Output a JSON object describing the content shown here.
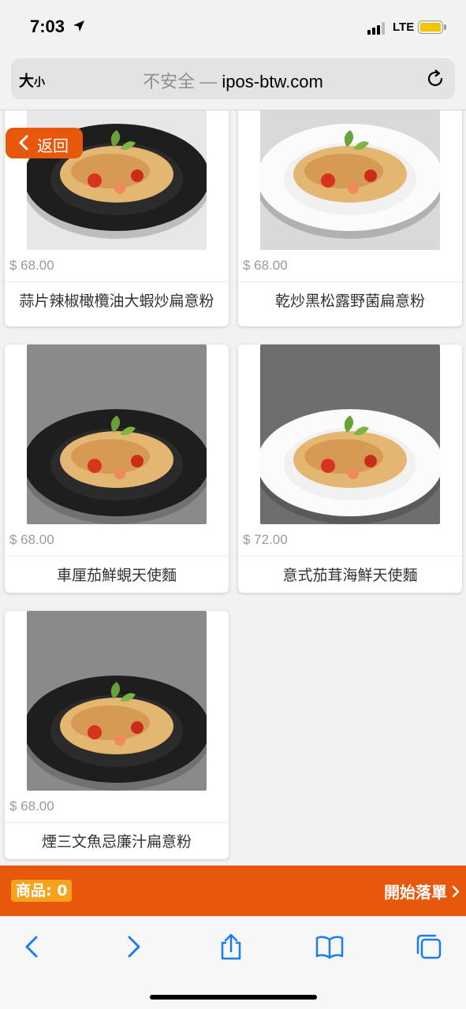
{
  "status_bar": {
    "time": "7:03",
    "network": "LTE",
    "battery_color": "#f5c400"
  },
  "browser": {
    "text_size_label_big": "大",
    "text_size_label_small": "小",
    "insecure_label": "不安全 —",
    "domain": "ipos-btw.com"
  },
  "page": {
    "back_label": "返回",
    "accent_color": "#e8580c",
    "products": [
      {
        "price": "$ 68.00",
        "name": "蒜片辣椒橄欖油大蝦炒扁意粉",
        "plate": "dark"
      },
      {
        "price": "$ 68.00",
        "name": "乾炒黑松露野菌扁意粉",
        "plate": "white"
      },
      {
        "price": "$ 68.00",
        "name": "車厘茄鮮蜆天使麵",
        "plate": "dark"
      },
      {
        "price": "$ 72.00",
        "name": "意式茄茸海鮮天使麵",
        "plate": "white"
      },
      {
        "price": "$ 68.00",
        "name": "煙三文魚忌廉汁扁意粉",
        "plate": "dark"
      }
    ]
  },
  "order_bar": {
    "count_label": "商品: 0",
    "checkout_label": "開始落單"
  },
  "toolbar": {
    "icons": [
      "back-icon",
      "forward-icon",
      "share-icon",
      "bookmarks-icon",
      "tabs-icon"
    ],
    "tint_color": "#1a7cf5"
  }
}
